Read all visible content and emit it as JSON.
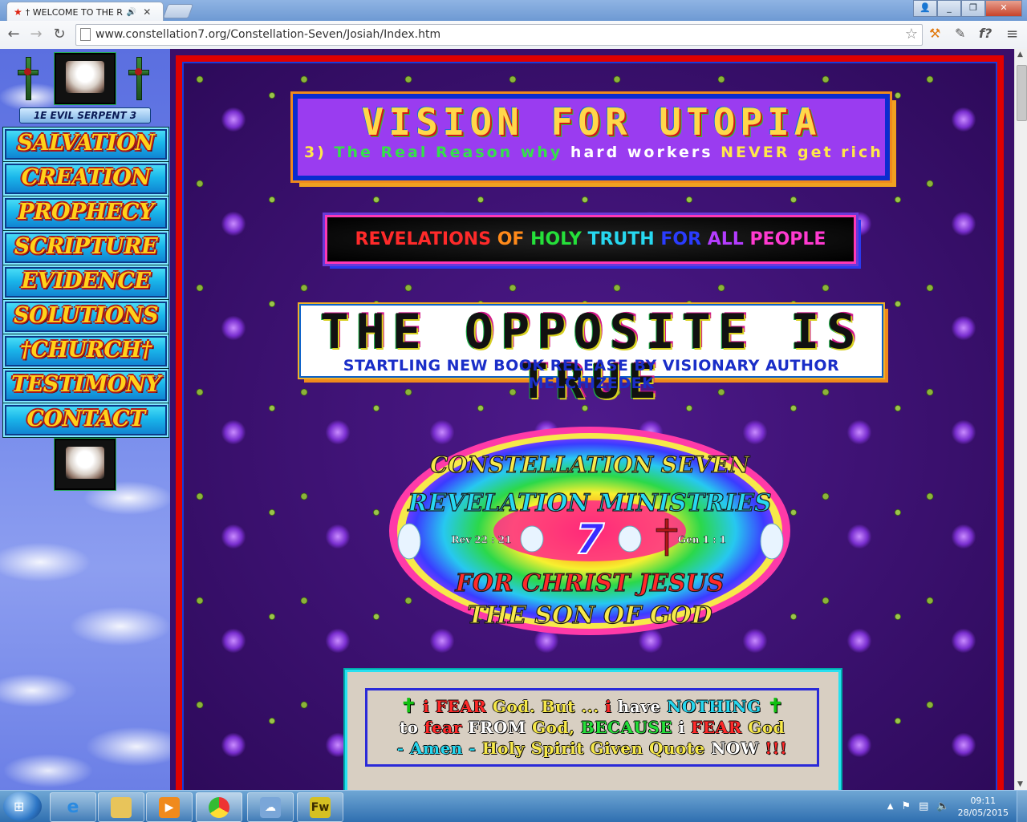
{
  "browser": {
    "tab_title": "† WELCOME TO THE RE",
    "url": "www.constellation7.org/Constellation-Seven/Josiah/Index.htm",
    "ext_label": "f?"
  },
  "sidebar": {
    "serpent_label": "1E EVIL SERPENT 3",
    "items": [
      {
        "label": "SALVATION"
      },
      {
        "label": "CREATION"
      },
      {
        "label": "PROPHECY"
      },
      {
        "label": "SCRIPTURE"
      },
      {
        "label": "EVIDENCE"
      },
      {
        "label": "SOLUTIONS"
      },
      {
        "label": "†CHURCH†"
      },
      {
        "label": "TESTIMONY"
      },
      {
        "label": "CONTACT"
      }
    ]
  },
  "vision": {
    "title": "VISION FOR UTOPIA",
    "sub_num": "3)",
    "sub_a": "The Real Reason why",
    "sub_b": "hard workers",
    "sub_c": "NEVER",
    "sub_d": "get rich"
  },
  "revelations": {
    "w1": "REVELATIONS",
    "w2": "OF",
    "w3": "HOLY",
    "w4": "TRUTH",
    "w5": "FOR",
    "w6": "ALL",
    "w7": "PEOPLE"
  },
  "opposite": {
    "title": "THE OPPOSITE IS TRUE",
    "subtitle": "STARTLING NEW BOOK RELEASE BY VISIONARY AUTHOR MELCHIZEDEK"
  },
  "logo": {
    "top": "CONSTELLATION SEVEN",
    "mid": "REVELATION MINISTRIES",
    "left_ref": "Rev 22 : 21",
    "right_ref": "Gen 1 : 1",
    "number": "7",
    "bot1": "FOR CHRIST JESUS",
    "bot2": "THE SON OF GOD"
  },
  "quote": {
    "l1": [
      "i",
      "FEAR",
      "God. But ...",
      "i",
      "have",
      "NOTHING"
    ],
    "l2": [
      "to",
      "fear",
      "FROM",
      "God,",
      "BECAUSE",
      "i",
      "FEAR",
      "God"
    ],
    "l3": [
      "- Amen -",
      "Holy Spirit Given Quote",
      "NOW",
      "!!!"
    ]
  },
  "taskbar": {
    "time": "09:11",
    "date": "28/05/2015",
    "fw_label": "Fw"
  }
}
